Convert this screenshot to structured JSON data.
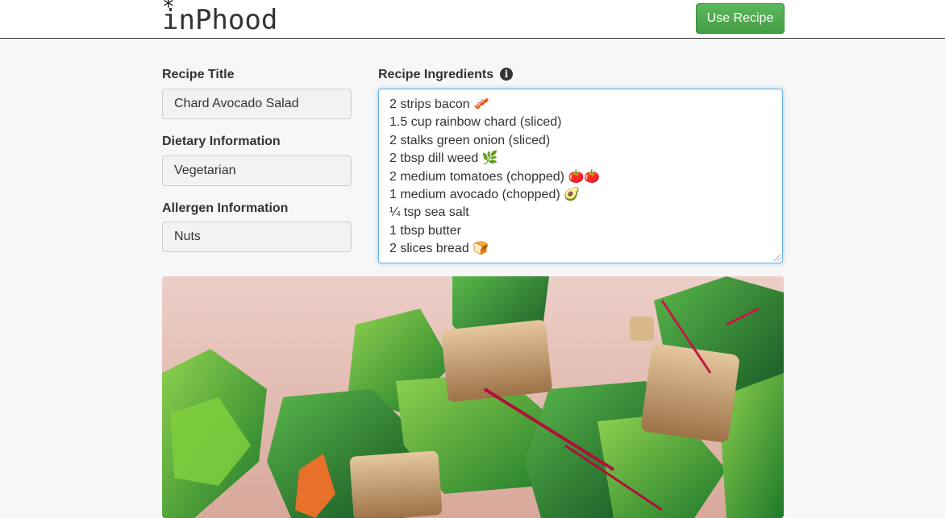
{
  "app": {
    "logo_text": "inPhood",
    "use_recipe_label": "Use Recipe"
  },
  "recipe": {
    "title_label": "Recipe Title",
    "title_value": "Chard Avocado Salad",
    "dietary_label": "Dietary Information",
    "dietary_value": "Vegetarian",
    "allergen_label": "Allergen Information",
    "allergen_value": "Nuts",
    "ingredients_label": "Recipe Ingredients",
    "info_icon": "info-circle-icon",
    "ingredients": [
      "2 strips bacon 🥓",
      "1.5 cup rainbow chard (sliced)",
      "2 stalks green onion (sliced)",
      "2 tbsp dill weed 🌿",
      "2 medium tomatoes (chopped) 🍅🍅",
      "1 medium avocado (chopped) 🥑",
      "¼ tsp sea salt",
      "1 tbsp butter",
      "2 slices bread 🍞"
    ]
  },
  "colors": {
    "accent_green": "#5cb85c",
    "focus_blue": "#66afe9"
  }
}
